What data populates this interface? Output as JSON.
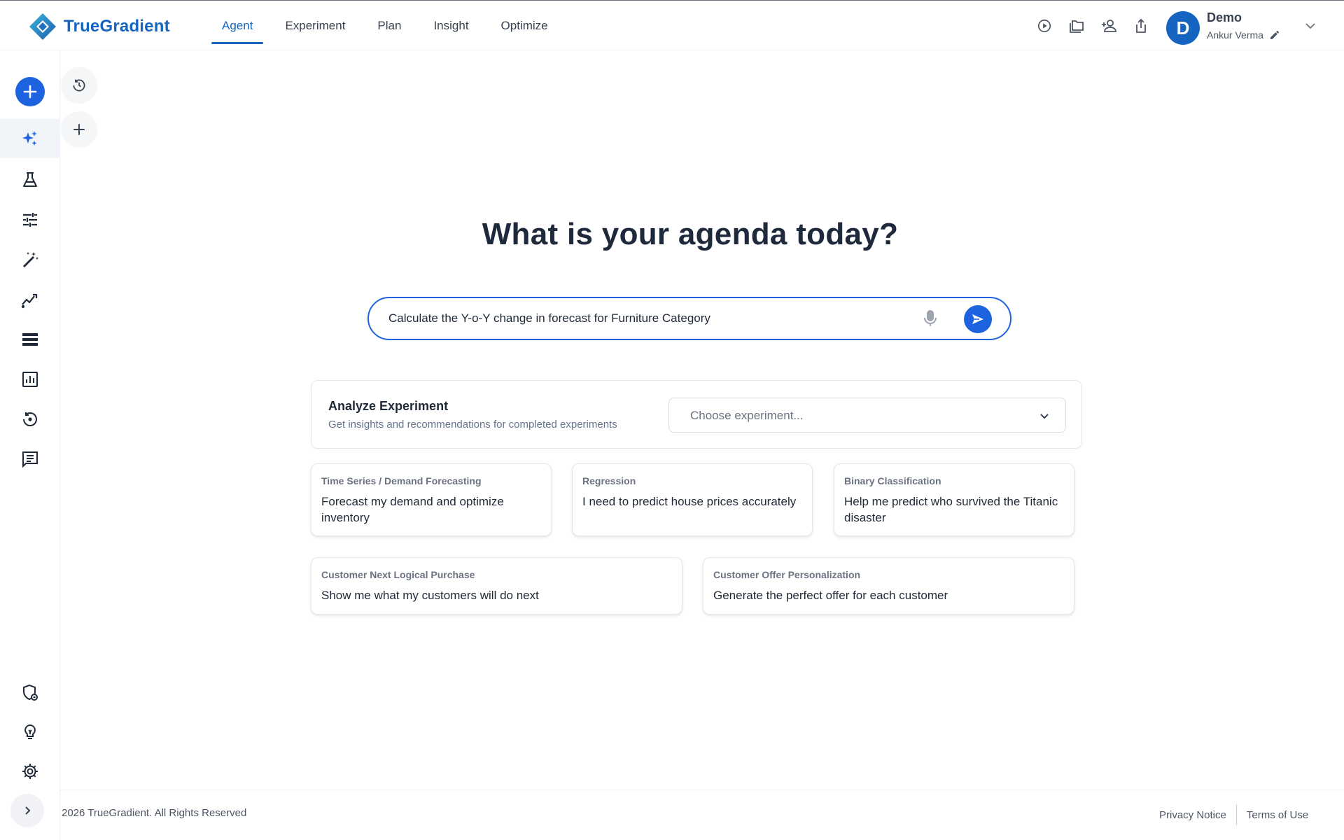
{
  "app": {
    "brand": "TrueGradient"
  },
  "nav": {
    "items": [
      {
        "label": "Agent",
        "active": true
      },
      {
        "label": "Experiment",
        "active": false
      },
      {
        "label": "Plan",
        "active": false
      },
      {
        "label": "Insight",
        "active": false
      },
      {
        "label": "Optimize",
        "active": false
      }
    ]
  },
  "top_actions": [
    "play-circle-icon",
    "folders-icon",
    "add-user-icon",
    "share-icon"
  ],
  "user": {
    "initial": "D",
    "org": "Demo",
    "name": "Ankur Verma"
  },
  "sidebar": {
    "items": [
      "sparkles-icon",
      "flask-icon",
      "sliders-icon",
      "magic-wand-icon",
      "trend-chart-icon",
      "storage-list-icon",
      "bar-chart-icon",
      "history-icon",
      "message-list-icon"
    ],
    "bottom": [
      "shield-icon",
      "lightbulb-icon",
      "gear-icon"
    ]
  },
  "main": {
    "headline": "What is your agenda today?",
    "prompt_value": "Calculate the Y-o-Y change in forecast for Furniture Category",
    "analyze": {
      "title": "Analyze Experiment",
      "subtitle": "Get insights and recommendations for completed experiments",
      "select_placeholder": "Choose experiment..."
    },
    "cards": [
      {
        "category": "Time Series / Demand Forecasting",
        "text": "Forecast my demand and optimize inventory"
      },
      {
        "category": "Regression",
        "text": "I need to predict house prices accurately"
      },
      {
        "category": "Binary Classification",
        "text": "Help me predict who survived the Titanic disaster"
      },
      {
        "category": "Customer Next Logical Purchase",
        "text": "Show me what my customers will do next"
      },
      {
        "category": "Customer Offer Personalization",
        "text": "Generate the perfect offer for each customer"
      }
    ]
  },
  "footer": {
    "copyright": "2026 TrueGradient. All Rights Reserved",
    "privacy": "Privacy Notice",
    "terms": "Terms of Use"
  },
  "colors": {
    "brand": "#1565c0",
    "accent": "#1d63e0"
  }
}
